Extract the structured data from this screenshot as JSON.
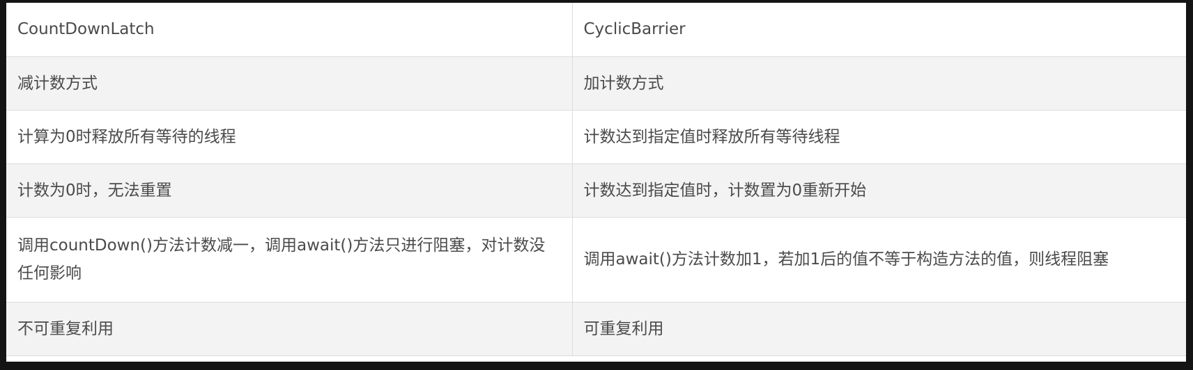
{
  "table": {
    "headers": [
      "CountDownLatch",
      "CyclicBarrier"
    ],
    "rows": [
      [
        "减计数方式",
        "加计数方式"
      ],
      [
        "计算为0时释放所有等待的线程",
        "计数达到指定值时释放所有等待线程"
      ],
      [
        "计数为0时，无法重置",
        "计数达到指定值时，计数置为0重新开始"
      ],
      [
        "调用countDown()方法计数减一，调用await()方法只进行阻塞，对计数没任何影响",
        "调用await()方法计数加1，若加1后的值不等于构造方法的值，则线程阻塞"
      ],
      [
        "不可重复利用",
        "可重复利用"
      ]
    ]
  }
}
